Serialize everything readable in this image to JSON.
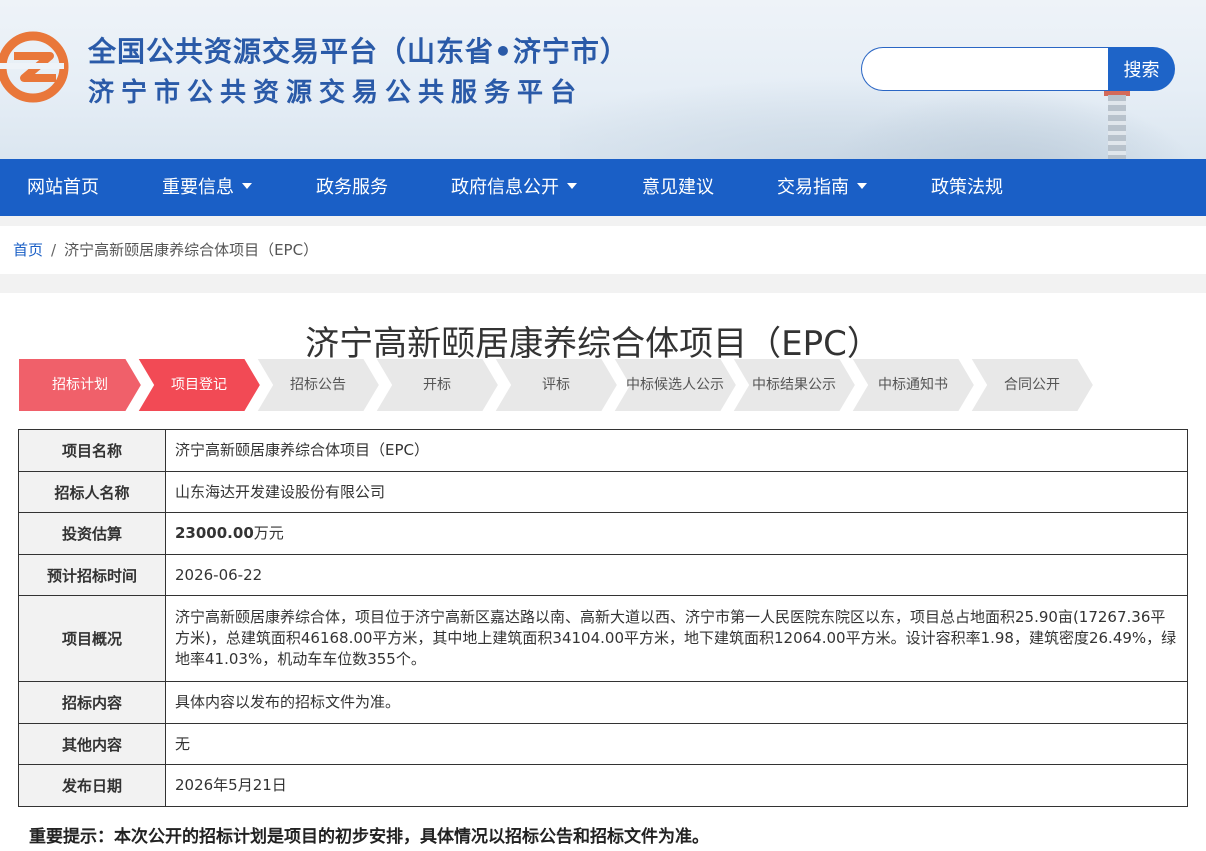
{
  "header": {
    "title_line1": "全国公共资源交易平台（山东省•济宁市）",
    "title_line2": "济宁市公共资源交易公共服务平台",
    "search_placeholder": "",
    "search_button": "搜索"
  },
  "nav": {
    "items": [
      {
        "label": "网站首页",
        "dropdown": false
      },
      {
        "label": "重要信息",
        "dropdown": true
      },
      {
        "label": "政务服务",
        "dropdown": false
      },
      {
        "label": "政府信息公开",
        "dropdown": true
      },
      {
        "label": "意见建议",
        "dropdown": false
      },
      {
        "label": "交易指南",
        "dropdown": true
      },
      {
        "label": "政策法规",
        "dropdown": false
      }
    ]
  },
  "breadcrumb": {
    "home": "首页",
    "separator": "/",
    "current": "济宁高新颐居康养综合体项目（EPC）"
  },
  "page_title": "济宁高新颐居康养综合体项目（EPC）",
  "steps": [
    {
      "label": "招标计划",
      "state": "done"
    },
    {
      "label": "项目登记",
      "state": "active"
    },
    {
      "label": "招标公告",
      "state": "pending"
    },
    {
      "label": "开标",
      "state": "pending"
    },
    {
      "label": "评标",
      "state": "pending"
    },
    {
      "label": "中标候选人公示",
      "state": "pending"
    },
    {
      "label": "中标结果公示",
      "state": "pending"
    },
    {
      "label": "中标通知书",
      "state": "pending"
    },
    {
      "label": "合同公开",
      "state": "pending"
    }
  ],
  "info": {
    "project_name": {
      "label": "项目名称",
      "value": "济宁高新颐居康养综合体项目（EPC）"
    },
    "tenderer": {
      "label": "招标人名称",
      "value": "山东海达开发建设股份有限公司"
    },
    "investment": {
      "label": "投资估算",
      "amount": "23000.00",
      "unit": "万元"
    },
    "tender_time": {
      "label": "预计招标时间",
      "value": "2026-06-22"
    },
    "overview": {
      "label": "项目概况",
      "value": "济宁高新颐居康养综合体，项目位于济宁高新区嘉达路以南、高新大道以西、济宁市第一人民医院东院区以东，项目总占地面积25.90亩(17267.36平方米)，总建筑面积46168.00平方米，其中地上建筑面积34104.00平方米，地下建筑面积12064.00平方米。设计容积率1.98，建筑密度26.49%，绿地率41.03%，机动车车位数355个。"
    },
    "content": {
      "label": "招标内容",
      "value": "具体内容以发布的招标文件为准。"
    },
    "other": {
      "label": "其他内容",
      "value": "无"
    },
    "publish_date": {
      "label": "发布日期",
      "value": "2026年5月21日"
    }
  },
  "notice": "重要提示：本次公开的招标计划是项目的初步安排，具体情况以招标公告和招标文件为准。",
  "colors": {
    "brand_blue": "#1a5fc6",
    "title_blue": "#2a5aa8",
    "step_done": "#f0606a",
    "step_active": "#f24a55",
    "step_pending": "#e8e8e8"
  }
}
